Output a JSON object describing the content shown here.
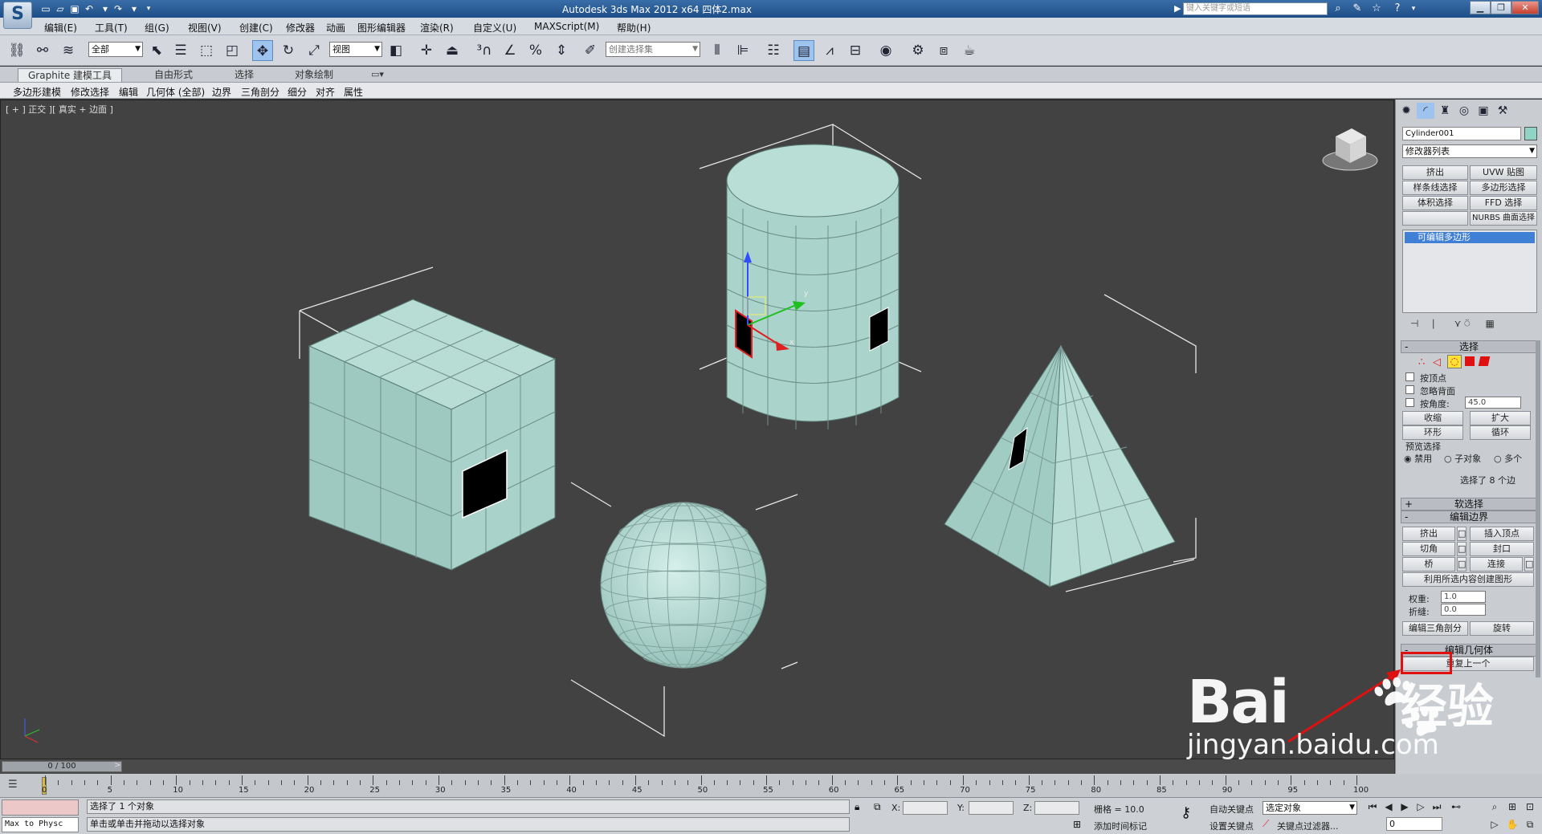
{
  "window": {
    "title": "Autodesk 3ds Max  2012 x64    四体2.max",
    "app_logo": "S",
    "help_search_placeholder": "键入关键字或短语"
  },
  "quick_access": [
    "new-icon",
    "open-icon",
    "save-icon",
    "undo-icon",
    "redo-icon"
  ],
  "menu": [
    "编辑(E)",
    "工具(T)",
    "组(G)",
    "视图(V)",
    "创建(C)",
    "修改器",
    "动画",
    "图形编辑器",
    "渲染(R)",
    "自定义(U)",
    "MAXScript(M)",
    "帮助(H)"
  ],
  "toolbar": {
    "selection_filter": "全部",
    "ref_coord": "视图",
    "named_selection": "创建选择集"
  },
  "ribbon": {
    "tabs": [
      "Graphite 建模工具",
      "自由形式",
      "选择",
      "对象绘制"
    ]
  },
  "subribbon": [
    "多边形建模",
    "修改选择",
    "编辑",
    "几何体 (全部)",
    "边界",
    "三角剖分",
    "细分",
    "对齐",
    "属性"
  ],
  "viewport": {
    "label": "[ + ] 正交 ][ 真实 + 边面 ]"
  },
  "command_panel": {
    "object_name": "Cylinder001",
    "object_color": "#8fd4c4",
    "modifier_list": "修改器列表",
    "mod_buttons": [
      "挤出",
      "UVW 贴图",
      "样条线选择",
      "多边形选择",
      "体积选择",
      "FFD 选择",
      "",
      "NURBS 曲面选择"
    ],
    "stack_item": "可编辑多边形",
    "selection": {
      "title": "选择",
      "by_vertex": "按顶点",
      "ignore_backface": "忽略背面",
      "by_angle": "按角度:",
      "angle_value": "45.0",
      "shrink": "收缩",
      "grow": "扩大",
      "ring": "环形",
      "loop": "循环",
      "preview_title": "预览选择",
      "preview_opts": [
        "禁用",
        "子对象",
        "多个"
      ],
      "status": "选择了 8 个边"
    },
    "soft_selection": "软选择",
    "edit_border": {
      "title": "编辑边界",
      "extrude": "挤出",
      "insert_vertex": "插入顶点",
      "chamfer": "切角",
      "cap": "封口",
      "bridge": "桥",
      "connect": "连接",
      "create_shape": "利用所选内容创建图形",
      "weight_label": "权重:",
      "weight": "1.0",
      "crease_label": "折缝:",
      "crease": "0.0",
      "edit_tri": "编辑三角剖分",
      "turn": "旋转"
    },
    "edit_geometry": "编辑几何体",
    "repeat_last": "重复上一个"
  },
  "timeline": {
    "slider": "0 / 100",
    "ticks": [
      "0",
      "5",
      "10",
      "15",
      "20",
      "25",
      "30",
      "35",
      "40",
      "45",
      "50",
      "55",
      "60",
      "65",
      "70",
      "75",
      "80",
      "85",
      "90",
      "95",
      "100"
    ]
  },
  "status": {
    "script_listener": "Max to Physc",
    "selected": "选择了 1 个对象",
    "hint": "单击或单击并拖动以选择对象",
    "x_label": "X:",
    "y_label": "Y:",
    "z_label": "Z:",
    "grid": "栅格 = 10.0",
    "auto_key": "自动关键点",
    "set_key": "设置关键点",
    "key_mode": "选定对象",
    "key_filter": "关键点过滤器...",
    "add_time_tag": "添加时间标记",
    "frame": "0"
  },
  "watermark": {
    "brand": "Bai",
    "paw": "经验",
    "url": "jingyan.baidu.com"
  }
}
